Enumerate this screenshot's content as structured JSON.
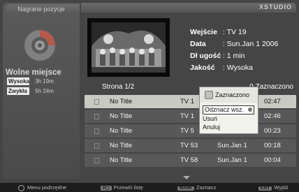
{
  "sidebar": {
    "title": "Nagrane pozycje",
    "free_label": "Wolne miejsce",
    "quality": [
      {
        "name": "Wysoka",
        "time": "3h 19m"
      },
      {
        "name": "Zwykła",
        "time": "5h 24m"
      }
    ]
  },
  "header": {
    "brand": "XSTUDIO"
  },
  "details": {
    "rows": [
      {
        "key": "Wejście",
        "value": ": TV 19"
      },
      {
        "key": "Data",
        "value": ": Sun.Jan 1 2006"
      },
      {
        "key": "Dł ugość",
        "value": ": 1 min"
      },
      {
        "key": "Jakość",
        "value": ": Wysoka"
      }
    ]
  },
  "list": {
    "page": "Strona   1/2",
    "selected_count": "0   Zaznaczono",
    "rows": [
      {
        "title": "No Title",
        "channel": "TV 1",
        "date": "",
        "time": "02:47",
        "selected": true
      },
      {
        "title": "No Title",
        "channel": "TV 1",
        "date": "",
        "time": "02:46",
        "selected": false
      },
      {
        "title": "No Title",
        "channel": "TV 5",
        "date": "",
        "time": "00:23",
        "selected": false
      },
      {
        "title": "No Title",
        "channel": "TV 53",
        "date": "Sun.Jan 1",
        "time": "00:18",
        "selected": false
      },
      {
        "title": "No Title",
        "channel": "TV 58",
        "date": "Sun.Jan 1",
        "time": "00:04",
        "selected": false
      }
    ]
  },
  "popup": {
    "header": "Zaznaczono",
    "items": [
      "Odznacz wsz.",
      "Usuń",
      "Anuluj"
    ]
  },
  "footer": {
    "items": [
      {
        "key": "",
        "label": "Menu podrzędne"
      },
      {
        "key": "P▢",
        "label": "Przewiń listę"
      },
      {
        "key": "MARK",
        "label": "Zaznacz"
      },
      {
        "key": "EXIT",
        "label": "Wyjdź"
      }
    ]
  },
  "colors": {
    "selected_row": "#c9c9c3",
    "row": "#585858",
    "background": "#454545"
  }
}
